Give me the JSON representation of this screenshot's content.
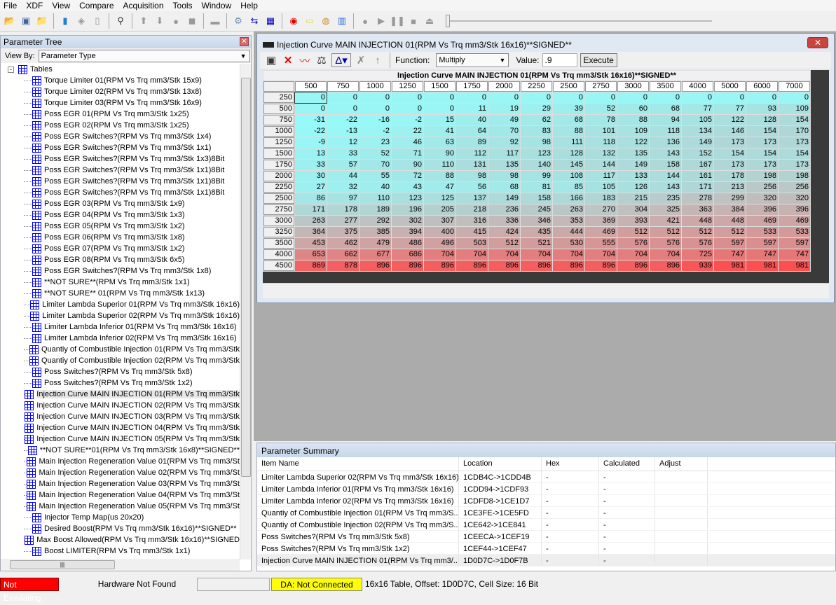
{
  "menu": [
    "File",
    "XDF",
    "View",
    "Compare",
    "Acquisition",
    "Tools",
    "Window",
    "Help"
  ],
  "toolbar_icons": [
    "open-folder-icon",
    "save-icon",
    "open-recent-icon",
    "bin-file-icon",
    "new-xdf-icon",
    "blank-page-icon",
    "cable-icon",
    "arrow-up-icon",
    "arrow-down-icon",
    "circle-icon",
    "copy-icon",
    "chip-icon",
    "gear-icon",
    "swap-arrows-icon",
    "table-import-icon",
    "emulator-icon",
    "notepad-icon",
    "info-gauge-icon",
    "bar-chart-icon",
    "record-icon",
    "play-icon",
    "pause-icon",
    "stop-icon",
    "eject-icon"
  ],
  "left_panel": {
    "title": "Parameter Tree",
    "view_by_label": "View By:",
    "view_by_value": "Parameter Type",
    "root": "Tables",
    "items": [
      "Torque Limiter 01(RPM Vs Trq mm3/Stk 15x9)",
      "Torque Limiter 02(RPM Vs Trq mm3/Stk 13x8)",
      "Torque Limiter 03(RPM Vs Trq mm3/Stk 16x9)",
      "Poss EGR 01(RPM Vs Trq mm3/Stk 1x25)",
      "Poss EGR 02(RPM Vs Trq mm3/Stk 1x25)",
      "Poss EGR Switches?(RPM Vs Trq mm3/Stk 1x4)",
      "Poss EGR Switches?(RPM Vs Trq mm3/Stk 1x1)",
      "Poss EGR Switches?(RPM Vs Trq mm3/Stk 1x3)8Bit",
      "Poss EGR Switches?(RPM Vs Trq mm3/Stk 1x1)8Bit",
      "Poss EGR Switches?(RPM Vs Trq mm3/Stk 1x1)8Bit",
      "Poss EGR Switches?(RPM Vs Trq mm3/Stk 1x1)8Bit",
      "Poss EGR 03(RPM Vs Trq mm3/Stk 1x9)",
      "Poss EGR 04(RPM Vs Trq mm3/Stk 1x3)",
      "Poss EGR 05(RPM Vs Trq mm3/Stk 1x2)",
      "Poss EGR 06(RPM Vs Trq mm3/Stk 1x8)",
      "Poss EGR 07(RPM Vs Trq mm3/Stk 1x2)",
      "Poss EGR 08(RPM Vs Trq mm3/Stk 6x5)",
      "Poss EGR Switches?(RPM Vs Trq mm3/Stk 1x8)",
      "**NOT SURE**(RPM Vs Trq mm3/Stk 1x1)",
      "**NOT SURE** 01(RPM Vs Trq mm3/Stk 1x13)",
      "Limiter Lambda Superior 01(RPM Vs Trq mm3/Stk 16x16)",
      "Limiter Lambda Superior 02(RPM Vs Trq mm3/Stk 16x16)",
      "Limiter Lambda Inferior 01(RPM Vs Trq mm3/Stk 16x16)",
      "Limiter Lambda Inferior 02(RPM Vs Trq mm3/Stk 16x16)",
      "Quantiy of Combustible Injection 01(RPM Vs Trq mm3/Stk",
      "Quantiy of Combustible Injection 02(RPM Vs Trq mm3/Stk",
      "Poss Switches?(RPM Vs Trq mm3/Stk 5x8)",
      "Poss Switches?(RPM Vs Trq mm3/Stk 1x2)",
      "Injection Curve MAIN INJECTION 01(RPM Vs Trq mm3/Stk",
      "Injection Curve MAIN INJECTION 02(RPM Vs Trq mm3/Stk",
      "Injection Curve MAIN INJECTION 03(RPM Vs Trq mm3/Stk",
      "Injection Curve MAIN INJECTION 04(RPM Vs Trq mm3/Stk",
      "Injection Curve MAIN INJECTION 05(RPM Vs Trq mm3/Stk",
      "**NOT SURE**01(RPM Vs Trq mm3/Stk 16x8)**SIGNED**",
      "Main Injection Regeneration Value 01(RPM Vs Trq mm3/St",
      "Main Injection Regeneration Value 02(RPM Vs Trq mm3/St",
      "Main Injection Regeneration Value 03(RPM Vs Trq mm3/St",
      "Main Injection Regeneration Value 04(RPM Vs Trq mm3/St",
      "Main Injection Regeneration Value 05(RPM Vs Trq mm3/St",
      "Injector Temp Map(us 20x20)",
      "Desired Boost(RPM Vs Trq mm3/Stk 16x16)**SIGNED**",
      "Max Boost Allowed(RPM Vs Trq mm3/Stk 16x16)**SIGNED",
      "Boost LIMITER(RPM Vs Trq mm3/Stk 1x1)"
    ],
    "selected_index": 28
  },
  "table_window": {
    "title": "Injection Curve MAIN INJECTION 01(RPM Vs Trq mm3/Stk 16x16)**SIGNED**",
    "function_label": "Function:",
    "function_value": "Multiply",
    "value_label": "Value:",
    "value": ".9",
    "execute_label": "Execute",
    "table_title": "Injection Curve MAIN INJECTION 01(RPM Vs Trq mm3/Stk 16x16)**SIGNED**",
    "col_headers": [
      "500",
      "750",
      "1000",
      "1250",
      "1500",
      "1750",
      "2000",
      "2250",
      "2500",
      "2750",
      "3000",
      "3500",
      "4000",
      "5000",
      "6000",
      "7000"
    ],
    "row_headers": [
      "250",
      "500",
      "750",
      "1000",
      "1250",
      "1500",
      "1750",
      "2000",
      "2250",
      "2500",
      "2750",
      "3000",
      "3250",
      "3500",
      "4000",
      "4500"
    ],
    "colors": {
      "low": "#96fafa",
      "mid": "#c0c0c0",
      "high": "#fa5050"
    },
    "cells": [
      [
        0,
        0,
        0,
        0,
        0,
        0,
        0,
        0,
        0,
        0,
        0,
        0,
        0,
        0,
        0,
        0
      ],
      [
        0,
        0,
        0,
        0,
        0,
        11,
        19,
        29,
        39,
        52,
        60,
        68,
        77,
        77,
        93,
        109
      ],
      [
        -31,
        -22,
        -16,
        -2,
        15,
        40,
        49,
        62,
        68,
        78,
        88,
        94,
        105,
        122,
        128,
        154
      ],
      [
        -22,
        -13,
        -2,
        22,
        41,
        64,
        70,
        83,
        88,
        101,
        109,
        118,
        134,
        146,
        154,
        170
      ],
      [
        -9,
        12,
        23,
        46,
        63,
        89,
        92,
        98,
        111,
        118,
        122,
        136,
        149,
        173,
        173,
        173
      ],
      [
        13,
        33,
        52,
        71,
        90,
        112,
        117,
        123,
        128,
        132,
        135,
        143,
        152,
        154,
        154,
        154
      ],
      [
        33,
        57,
        70,
        90,
        110,
        131,
        135,
        140,
        145,
        144,
        149,
        158,
        167,
        173,
        173,
        173
      ],
      [
        30,
        44,
        55,
        72,
        88,
        98,
        98,
        99,
        108,
        117,
        133,
        144,
        161,
        178,
        198,
        198
      ],
      [
        27,
        32,
        40,
        43,
        47,
        56,
        68,
        81,
        85,
        105,
        126,
        143,
        171,
        213,
        256,
        256
      ],
      [
        86,
        97,
        110,
        123,
        125,
        137,
        149,
        158,
        166,
        183,
        215,
        235,
        278,
        299,
        320,
        320
      ],
      [
        171,
        178,
        189,
        196,
        205,
        218,
        236,
        245,
        263,
        270,
        304,
        325,
        363,
        384,
        396,
        396
      ],
      [
        263,
        277,
        292,
        302,
        307,
        316,
        336,
        346,
        353,
        369,
        393,
        421,
        448,
        448,
        469,
        469
      ],
      [
        364,
        375,
        385,
        394,
        400,
        415,
        424,
        435,
        444,
        469,
        512,
        512,
        512,
        512,
        533,
        533
      ],
      [
        453,
        462,
        479,
        486,
        496,
        503,
        512,
        521,
        530,
        555,
        576,
        576,
        576,
        597,
        597,
        597
      ],
      [
        653,
        662,
        677,
        686,
        704,
        704,
        704,
        704,
        704,
        704,
        704,
        704,
        725,
        747,
        747,
        747
      ],
      [
        869,
        878,
        896,
        896,
        896,
        896,
        896,
        896,
        896,
        896,
        896,
        896,
        939,
        981,
        981,
        981
      ]
    ]
  },
  "summary": {
    "title": "Parameter Summary",
    "columns": [
      "Item Name",
      "Location",
      "Hex",
      "Calculated",
      "Adjust"
    ],
    "rows": [
      [
        "Limiter Lambda Superior 02(RPM Vs Trq mm3/Stk 16x16)",
        "1CDB4C->1CDD4B",
        "-",
        "-",
        ""
      ],
      [
        "Limiter Lambda Inferior 01(RPM Vs Trq mm3/Stk 16x16)",
        "1CDD94->1CDF93",
        "-",
        "-",
        ""
      ],
      [
        "Limiter Lambda Inferior 02(RPM Vs Trq mm3/Stk 16x16)",
        "1CDFD8->1CE1D7",
        "-",
        "-",
        ""
      ],
      [
        "Quantiy of Combustible Injection 01(RPM Vs Trq mm3/S...",
        "1CE3FE->1CE5FD",
        "-",
        "-",
        ""
      ],
      [
        "Quantiy of Combustible Injection 02(RPM Vs Trq mm3/S...",
        "1CE642->1CE841",
        "-",
        "-",
        ""
      ],
      [
        "Poss Switches?(RPM Vs Trq mm3/Stk 5x8)",
        "1CEECA->1CEF19",
        "-",
        "-",
        ""
      ],
      [
        "Poss Switches?(RPM Vs Trq mm3/Stk 1x2)",
        "1CEF44->1CEF47",
        "-",
        "-",
        ""
      ],
      [
        "Injection Curve MAIN INJECTION 01(RPM Vs Trq mm3/...",
        "1D0D7C->1D0F7B",
        "-",
        "-",
        ""
      ]
    ]
  },
  "status": {
    "emulating": "Not Emulating",
    "hardware": "Hardware Not Found",
    "da": "DA: Not Connected",
    "info": "16x16 Table, Offset: 1D0D7C,  Cell Size: 16 Bit",
    "emulating_color": "#ff0000",
    "da_color": "#ffff00"
  }
}
